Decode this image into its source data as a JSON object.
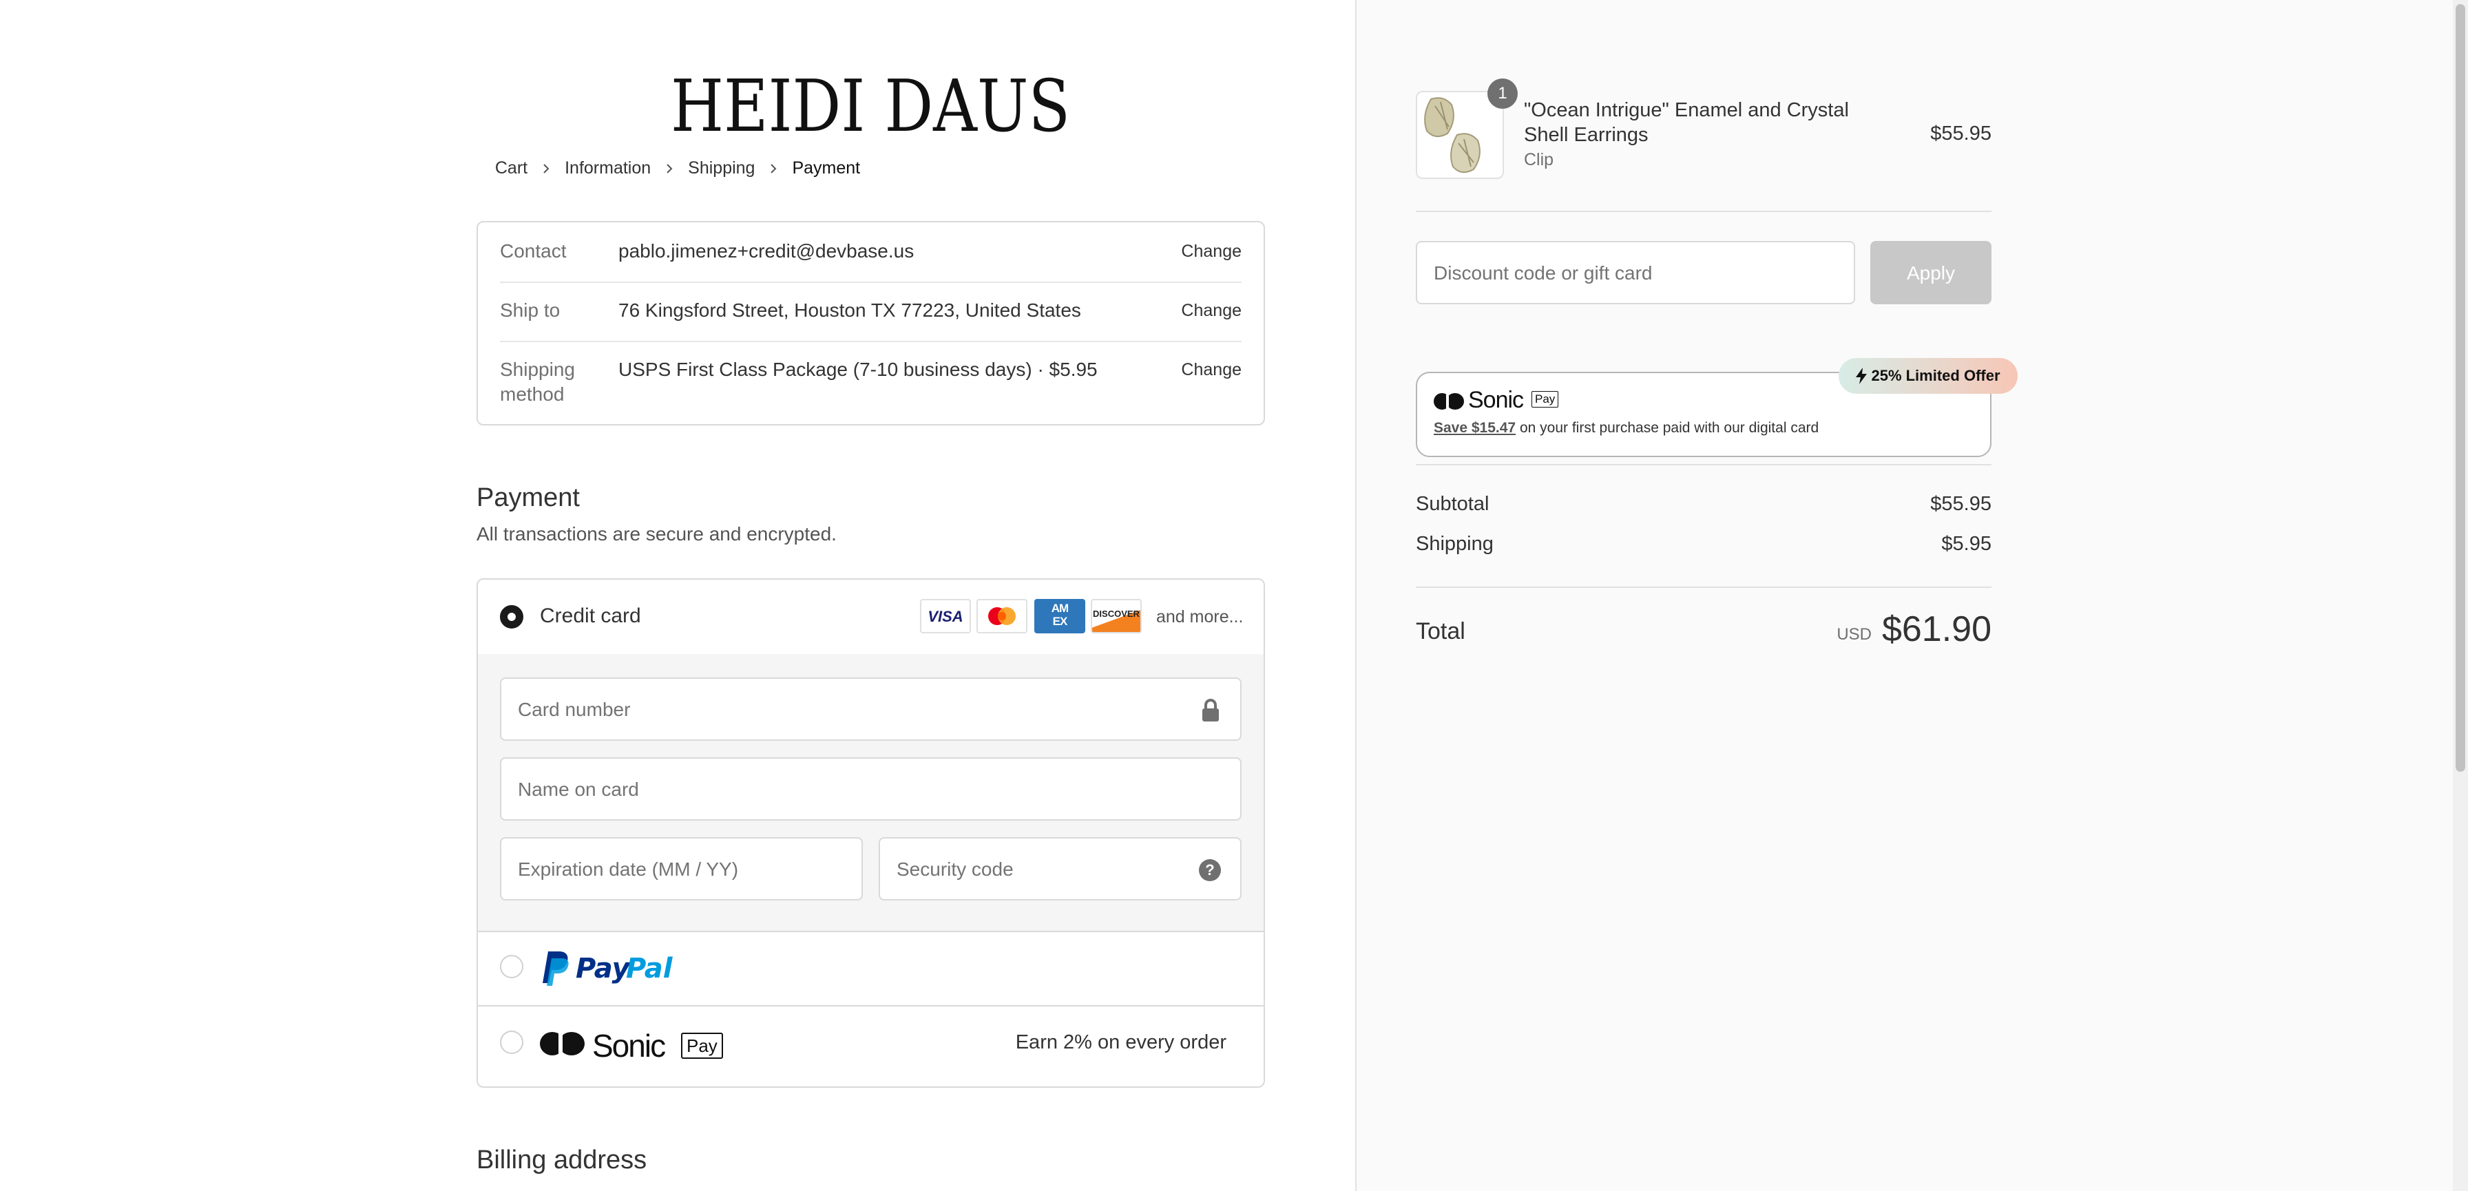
{
  "brand": {
    "logo_text": "HEIDI DAUS"
  },
  "breadcrumb": [
    "Cart",
    "Information",
    "Shipping",
    "Payment"
  ],
  "review": {
    "contact": {
      "label": "Contact",
      "value": "pablo.jimenez+credit@devbase.us",
      "change": "Change"
    },
    "ship_to": {
      "label": "Ship to",
      "value": "76 Kingsford Street, Houston TX 77223, United States",
      "change": "Change"
    },
    "method": {
      "label": "Shipping method",
      "value": "USPS First Class Package (7-10 business days) · $5.95",
      "change": "Change"
    }
  },
  "payment": {
    "title": "Payment",
    "subtitle": "All transactions are secure and encrypted.",
    "credit_card": {
      "label": "Credit card",
      "selected": true,
      "card_brands": [
        "VISA",
        "mastercard",
        "AMEX",
        "DISCOVER"
      ],
      "more": "and more...",
      "fields": {
        "card_number": "Card number",
        "name_on_card": "Name on card",
        "expiration": "Expiration date (MM / YY)",
        "security_code": "Security code"
      }
    },
    "paypal": {
      "label": "PayPal",
      "selected": false
    },
    "sonic": {
      "label": "Sonic",
      "pay_tag": "Pay",
      "note": "Earn 2% on every order",
      "selected": false
    }
  },
  "billing": {
    "title": "Billing address"
  },
  "summary": {
    "item": {
      "quantity": "1",
      "name": "\"Ocean Intrigue\" Enamel and Crystal Shell Earrings",
      "variant": "Clip",
      "price": "$55.95"
    },
    "discount_placeholder": "Discount code or gift card",
    "apply_label": "Apply",
    "sonic_promo": {
      "badge": "25% Limited Offer",
      "brand": "Sonic",
      "pay_tag": "Pay",
      "save": "Save $15.47",
      "text": " on your first purchase paid with our digital card"
    },
    "subtotal_label": "Subtotal",
    "subtotal": "$55.95",
    "shipping_label": "Shipping",
    "shipping": "$5.95",
    "total_label": "Total",
    "currency": "USD",
    "total": "$61.90"
  },
  "colors": {
    "paypal_dark": "#003087",
    "paypal_light": "#009cde",
    "disabled_button": "#c8c8c8"
  }
}
